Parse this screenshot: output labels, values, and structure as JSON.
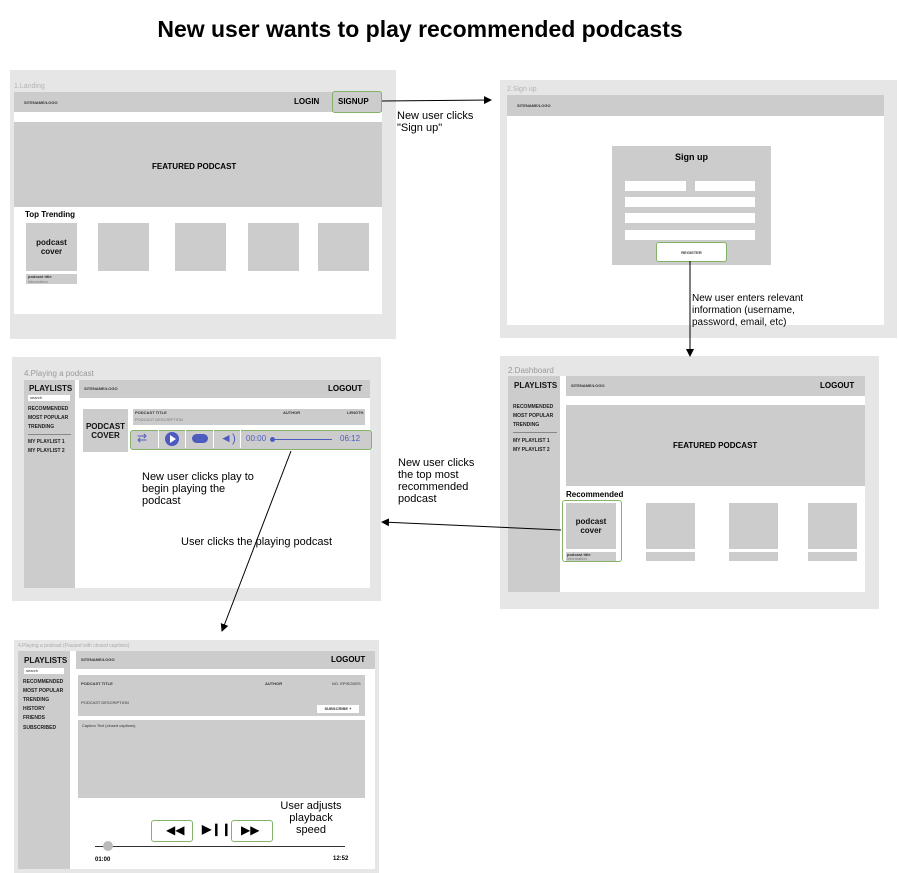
{
  "title": "New user wants to play recommended podcasts",
  "screens": {
    "landing": {
      "label": "1.Landing",
      "logo": "SITENAME/LOGO",
      "login": "LOGIN",
      "signup": "SIGNUP",
      "featured": "FEATURED PODCAST",
      "top_trending": "Top Trending",
      "cover": "podcast cover",
      "podcast_title": "podcast title",
      "information": "information"
    },
    "signup": {
      "label": "2.Sign up",
      "logo": "SITENAME/LOGO",
      "form_title": "Sign up",
      "register": "REGISTER"
    },
    "dashboard": {
      "label": "2.Dashboard",
      "playlists": "PLAYLISTS",
      "logo": "SITENAME/LOGO",
      "logout": "LOGOUT",
      "nav": [
        "RECOMMENDED",
        "MOST POPULAR",
        "TRENDING"
      ],
      "my_playlists": [
        "MY PLAYLIST 1",
        "MY PLAYLIST 2"
      ],
      "featured": "FEATURED PODCAST",
      "recommended": "Recommended",
      "cover": "podcast cover",
      "podcast_title": "podcast title",
      "information": "information"
    },
    "playing": {
      "label": "4.Playing a podcast",
      "playlists": "PLAYLISTS",
      "search": "search",
      "logo": "SITENAME/LOGO",
      "logout": "LOGOUT",
      "nav": [
        "RECOMMENDED",
        "MOST POPULAR",
        "TRENDING"
      ],
      "my_playlists": [
        "MY PLAYLIST 1",
        "MY PLAYLIST 2"
      ],
      "cover": "PODCAST COVER",
      "podcast_title": "PODCAST TITLE",
      "author": "AUTHOR",
      "length": "LENGTH",
      "description": "PODCAST DESCRIPTION",
      "time_start": "00:00",
      "time_end": "06:12",
      "progress": 0
    },
    "paused": {
      "label": "4.Playing a podcast (Paused with closed captions)",
      "playlists": "PLAYLISTS",
      "search": "search",
      "logo": "SITENAME/LOGO",
      "logout": "LOGOUT",
      "nav": [
        "RECOMMENDED",
        "MOST POPULAR",
        "TRENDING",
        "HISTORY",
        "FRIENDS",
        "SUBSCRIBED"
      ],
      "podcast_title": "PODCAST TITLE",
      "author": "AUTHOR",
      "episodes": "NO. EPISODES",
      "description": "PODCAST DESCRIPTION",
      "subscribe": "SUBSCRIBE +",
      "captions": "Caption Text (closed captions)",
      "time_start": "01:00",
      "time_end": "12:52"
    }
  },
  "annotations": {
    "a1": "New user clicks \"Sign up\"",
    "a2": "New user enters relevant information (username, password, email, etc)",
    "a3": "New user clicks the top most recommended podcast",
    "a4": "New user clicks play to begin playing the podcast",
    "a5": "User clicks the playing podcast",
    "a6": "User adjusts playback speed"
  },
  "colors": {
    "highlight": "#82b366",
    "accent": "#4d5bbf"
  }
}
